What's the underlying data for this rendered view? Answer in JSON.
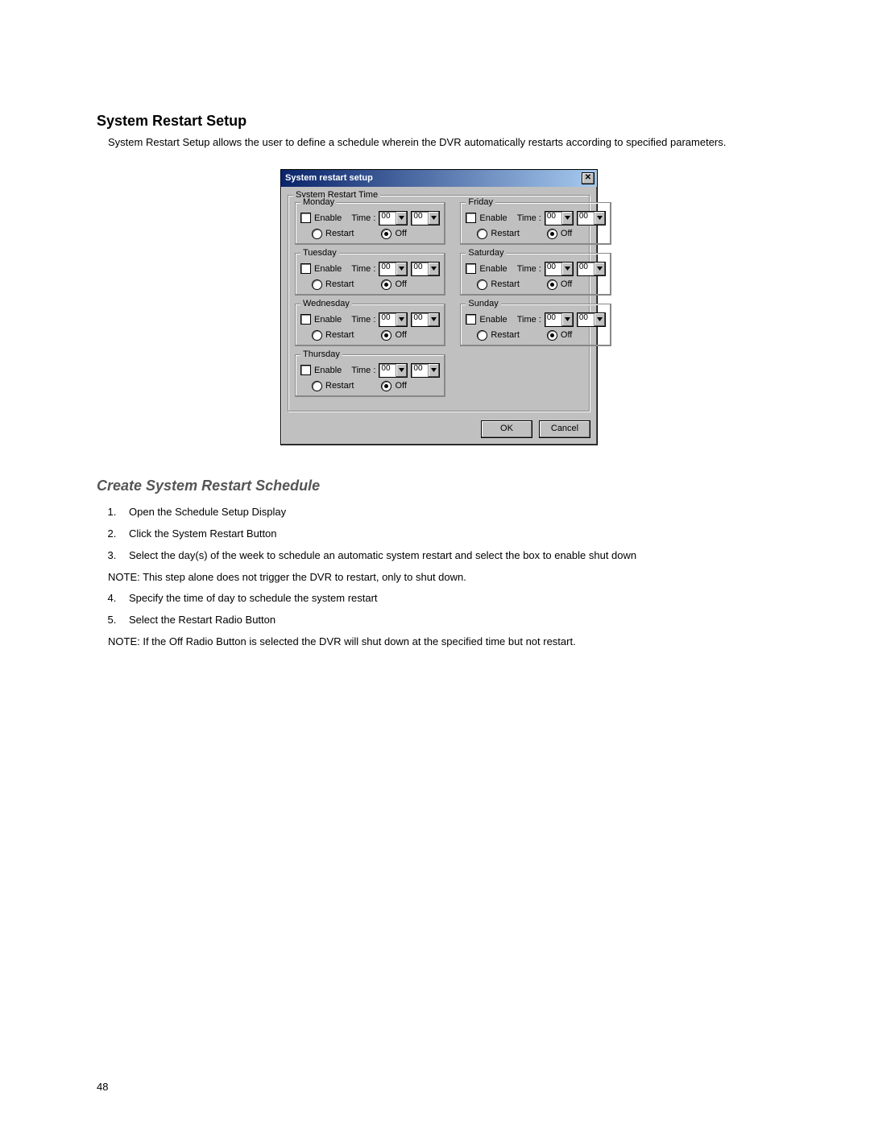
{
  "page_number": "48",
  "section_title": "System Restart Setup",
  "intro_text": "System Restart Setup allows the user to define a schedule wherein the DVR automatically restarts according to specified parameters.",
  "dialog": {
    "title": "System restart setup",
    "group_legend": "System Restart Time",
    "days_left": [
      "Monday",
      "Tuesday",
      "Wednesday",
      "Thursday"
    ],
    "days_right": [
      "Friday",
      "Saturday",
      "Sunday"
    ],
    "labels": {
      "enable": "Enable",
      "time": "Time :",
      "restart": "Restart",
      "off": "Off"
    },
    "time_hh": "00",
    "time_mm": "00",
    "buttons": {
      "ok": "OK",
      "cancel": "Cancel"
    }
  },
  "subsection_title": "Create System Restart Schedule",
  "steps": [
    "Open the Schedule Setup Display",
    "Click the System Restart Button",
    "Select the day(s) of the week to schedule an automatic system restart and select the box to enable shut down"
  ],
  "note1": "NOTE: This step alone does not trigger the DVR to restart, only to shut down.",
  "steps2": [
    "Specify the time of day to schedule the system restart",
    "Select the Restart Radio Button"
  ],
  "note2": "NOTE: If the Off Radio Button is selected the DVR will shut down at the specified time but not restart."
}
